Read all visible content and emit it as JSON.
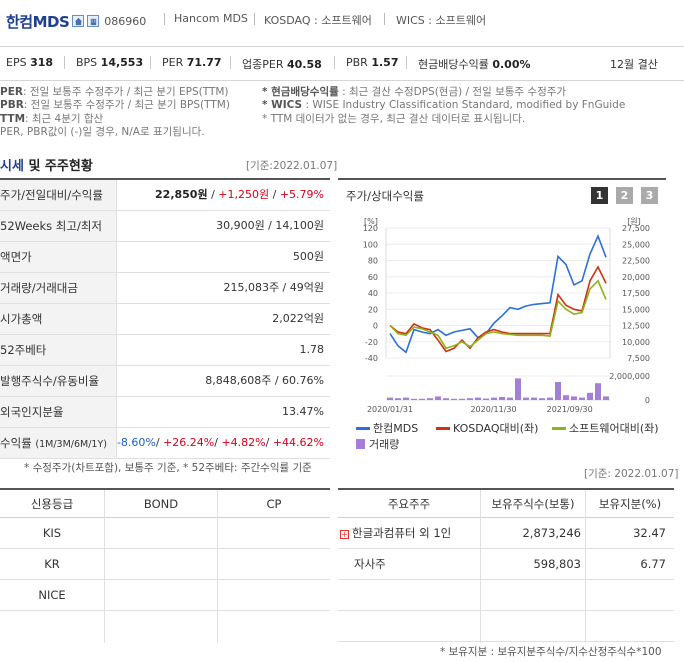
{
  "header": {
    "company_name": "한컴MDS",
    "stock_code": "086960",
    "english_name": "Hancom MDS",
    "market": "KOSDAQ : 소프트웨어",
    "wics": "WICS : 소프트웨어",
    "fiscal_month": "12월 결산",
    "metrics": [
      {
        "label": "EPS",
        "value": "318"
      },
      {
        "label": "BPS",
        "value": "14,553"
      },
      {
        "label": "PER",
        "value": "71.77"
      },
      {
        "label": "업종PER",
        "value": "40.58"
      },
      {
        "label": "PBR",
        "value": "1.57"
      },
      {
        "label": "현금배당수익률",
        "value": "0.00%"
      }
    ]
  },
  "notes": {
    "left": [
      {
        "key": "PER",
        "text": ": 전일 보통주 수정주가 / 최근 분기 EPS(TTM)"
      },
      {
        "key": "PBR",
        "text": ": 전일 보통주 수정주가 / 최근 분기 BPS(TTM)"
      },
      {
        "key": "TTM",
        "text": ": 최근 4분기 합산"
      },
      {
        "key": "",
        "text": "PER, PBR값이 (-)일 경우, N/A로 표기됩니다."
      }
    ],
    "right": [
      {
        "key": "* 현금배당수익률",
        "text": " : 최근 결산 수정DPS(현금) / 전일 보통주 수정주가"
      },
      {
        "key": "* WICS",
        "text": " : WISE Industry Classification Standard, modified by FnGuide"
      },
      {
        "key": "",
        "text": "* TTM 데이터가 없는 경우, 최근 결산 데이터로 표시됩니다."
      }
    ]
  },
  "section": {
    "title_a": "시세",
    "title_b": " 및 주주현황",
    "basis": "[기준:2022.01.07]",
    "basis2": "[기준: 2022.01.07]"
  },
  "quote_table": [
    {
      "label": "주가/전일대비/수익률",
      "v1": "22,850원",
      "v2": "+1,250원",
      "v3": "+5.79%"
    },
    {
      "label": "52Weeks 최고/최저",
      "value": "30,900원 / 14,100원"
    },
    {
      "label": "액면가",
      "value": "500원"
    },
    {
      "label": "거래량/거래대금",
      "value": "215,083주 / 49억원"
    },
    {
      "label": "시가총액",
      "value": "2,022억원"
    },
    {
      "label": "52주베타",
      "value": "1.78"
    },
    {
      "label": "발행주식수/유동비율",
      "value": "8,848,608주 / 60.76%"
    },
    {
      "label": "외국인지분율",
      "value": "13.47%"
    },
    {
      "label": "수익률",
      "label_small": "(1M/3M/6M/1Y)",
      "r1": "-8.60%",
      "r2": "+26.24%",
      "r3": "+4.82%",
      "r4": "+44.62%"
    }
  ],
  "quote_footnote": "* 수정주가(차트포함), 보통주 기준, * 52주베타: 주간수익률 기준",
  "chart_panel": {
    "title": "주가/상대수익률",
    "buttons": [
      "1",
      "2",
      "3"
    ],
    "legend": [
      {
        "name": "한컴MDS",
        "color": "#2f6fd6"
      },
      {
        "name": "KOSDAQ대비(좌)",
        "color": "#cc3311"
      },
      {
        "name": "소프트웨어대비(좌)",
        "color": "#8fb21b"
      },
      {
        "name": "거래량",
        "color": "#a57fd6"
      }
    ]
  },
  "chart_data": {
    "type": "line",
    "left_unit": "[%]",
    "right_unit": "[원]",
    "left_ticks": [
      "120",
      "100",
      "80",
      "60",
      "40",
      "20",
      "0",
      "-20",
      "-40"
    ],
    "right_ticks": [
      "27,500",
      "25,000",
      "22,500",
      "20,000",
      "17,500",
      "15,000",
      "12,500",
      "10,000",
      "7,500"
    ],
    "volume_tick": "2,000,000",
    "volume_tick_zero": "0",
    "x_labels": [
      "2020/01/31",
      "2020/11/30",
      "2021/09/30"
    ],
    "ylim": [
      -40,
      120
    ],
    "series": [
      {
        "name": "한컴MDS",
        "color": "#2f6fd6",
        "values": [
          -10,
          -25,
          -33,
          -5,
          -8,
          -10,
          -5,
          -12,
          -8,
          -6,
          -4,
          -15,
          -10,
          3,
          12,
          22,
          20,
          24,
          26,
          27,
          28,
          85,
          75,
          50,
          55,
          88,
          110,
          84
        ]
      },
      {
        "name": "KOSDAQ대비(좌)",
        "color": "#cc3311",
        "values": [
          0,
          -8,
          -10,
          2,
          -3,
          -5,
          -18,
          -32,
          -28,
          -18,
          -28,
          -15,
          -8,
          -5,
          -8,
          -10,
          -10,
          -10,
          -10,
          -10,
          -10,
          38,
          25,
          20,
          18,
          55,
          72,
          52
        ]
      },
      {
        "name": "소프트웨어대비(좌)",
        "color": "#8fb21b",
        "values": [
          0,
          -10,
          -12,
          -2,
          -4,
          -8,
          -12,
          -28,
          -25,
          -20,
          -26,
          -18,
          -10,
          -8,
          -10,
          -11,
          -12,
          -12,
          -12,
          -12,
          -13,
          30,
          20,
          14,
          16,
          45,
          55,
          32
        ]
      },
      {
        "name": "거래량",
        "color": "#a57fd6",
        "values": [
          200000,
          150000,
          200000,
          100000,
          100000,
          150000,
          300000,
          150000,
          100000,
          100000,
          150000,
          200000,
          120000,
          200000,
          250000,
          200000,
          1800000,
          200000,
          200000,
          150000,
          200000,
          1500000,
          400000,
          300000,
          200000,
          600000,
          1400000,
          300000
        ]
      }
    ]
  },
  "credit_table": {
    "headers": [
      "신용등급",
      "BOND",
      "CP"
    ],
    "rows": [
      "KIS",
      "KR",
      "NICE"
    ]
  },
  "holders_table": {
    "headers": [
      "주요주주",
      "보유주식수(보통)",
      "보유지분(%)"
    ],
    "rows": [
      {
        "name": "한글과컴퓨터 외 1인",
        "shares": "2,873,246",
        "pct": "32.47",
        "expand": true
      },
      {
        "name": "자사주",
        "shares": "598,803",
        "pct": "6.77",
        "expand": false
      }
    ],
    "footnote": "* 보유지분 : 보유지분주식수/지수산정주식수*100"
  }
}
